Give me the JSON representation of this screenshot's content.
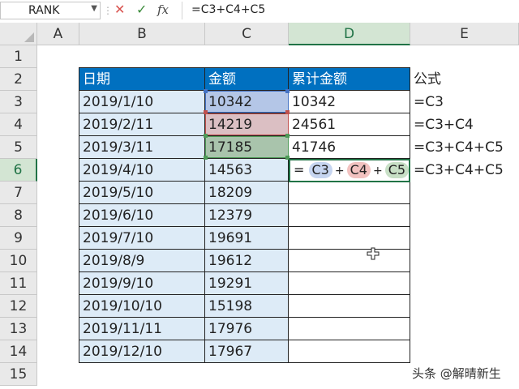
{
  "formula_bar": {
    "name_box": "RANK",
    "cancel_icon": "✕",
    "enter_icon": "✓",
    "fx_label": "fx",
    "formula": "=C3+C4+C5"
  },
  "columns": [
    "A",
    "B",
    "C",
    "D",
    "E"
  ],
  "rows": [
    "1",
    "2",
    "3",
    "4",
    "5",
    "6",
    "7",
    "8",
    "9",
    "10",
    "11",
    "12",
    "13",
    "14",
    "15"
  ],
  "table": {
    "headers": {
      "date": "日期",
      "amount": "金额",
      "cumulative": "累计金额",
      "formula": "公式"
    },
    "dates": [
      "2019/1/10",
      "2019/2/11",
      "2019/3/11",
      "2019/4/10",
      "2019/5/10",
      "2019/6/10",
      "2019/7/10",
      "2019/8/9",
      "2019/9/10",
      "2019/10/10",
      "2019/11/11",
      "2019/12/10"
    ],
    "amounts": [
      "10342",
      "14219",
      "17185",
      "14563",
      "18209",
      "12379",
      "19691",
      "19612",
      "19291",
      "15198",
      "17976",
      "17967"
    ],
    "cumulative": [
      "10342",
      "24561",
      "41746"
    ],
    "formulas": [
      "=C3",
      "=C3+C4",
      "=C3+C4+C5",
      "=C3+C4+C5"
    ]
  },
  "edit_cell": {
    "eq": "=",
    "ref1": "C3",
    "ref2": "C4",
    "ref3": "C5",
    "plus": "+"
  },
  "watermark": "头条 @解晴新生",
  "colors": {
    "header_blue": "#0070c0",
    "active_green": "#217346",
    "ref_blue": "#4472c4",
    "ref_red": "#c0504d",
    "ref_green": "#4e9a57"
  }
}
